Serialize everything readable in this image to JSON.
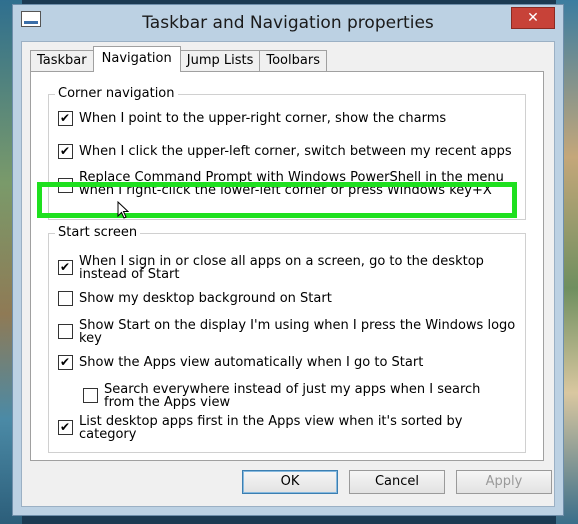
{
  "window": {
    "title": "Taskbar and Navigation properties",
    "close_glyph": "✕"
  },
  "tabs": [
    {
      "label": "Taskbar",
      "active": false
    },
    {
      "label": "Navigation",
      "active": true
    },
    {
      "label": "Jump Lists",
      "active": false
    },
    {
      "label": "Toolbars",
      "active": false
    }
  ],
  "corner_navigation": {
    "title": "Corner navigation",
    "options": [
      {
        "label": "When I point to the upper-right corner, show the charms",
        "checked": true
      },
      {
        "label": "When I click the upper-left corner, switch between my recent apps",
        "checked": true
      },
      {
        "label": "Replace Command Prompt with Windows PowerShell in the menu\nwhen I right-click the lower-left corner or press Windows key+X",
        "checked": false
      }
    ]
  },
  "start_screen": {
    "title": "Start screen",
    "options": [
      {
        "label": "When I sign in or close all apps on a screen, go to the desktop\ninstead of Start",
        "checked": true
      },
      {
        "label": "Show my desktop background on Start",
        "checked": false
      },
      {
        "label": "Show Start on the display I'm using when I press the Windows logo\nkey",
        "checked": false
      },
      {
        "label": "Show the Apps view automatically when I go to Start",
        "checked": true
      },
      {
        "label": "Search everywhere instead of just my apps when I search\nfrom the Apps view",
        "checked": false
      },
      {
        "label": "List desktop apps first in the Apps view when it's sorted by\ncategory",
        "checked": true
      }
    ]
  },
  "buttons": {
    "ok": "OK",
    "cancel": "Cancel",
    "apply": "Apply"
  },
  "colors": {
    "highlight": "#1fe01f",
    "close_button": "#c74238"
  },
  "icons": {
    "app": "taskbar-properties-icon",
    "cursor": "mouse-pointer-icon"
  }
}
